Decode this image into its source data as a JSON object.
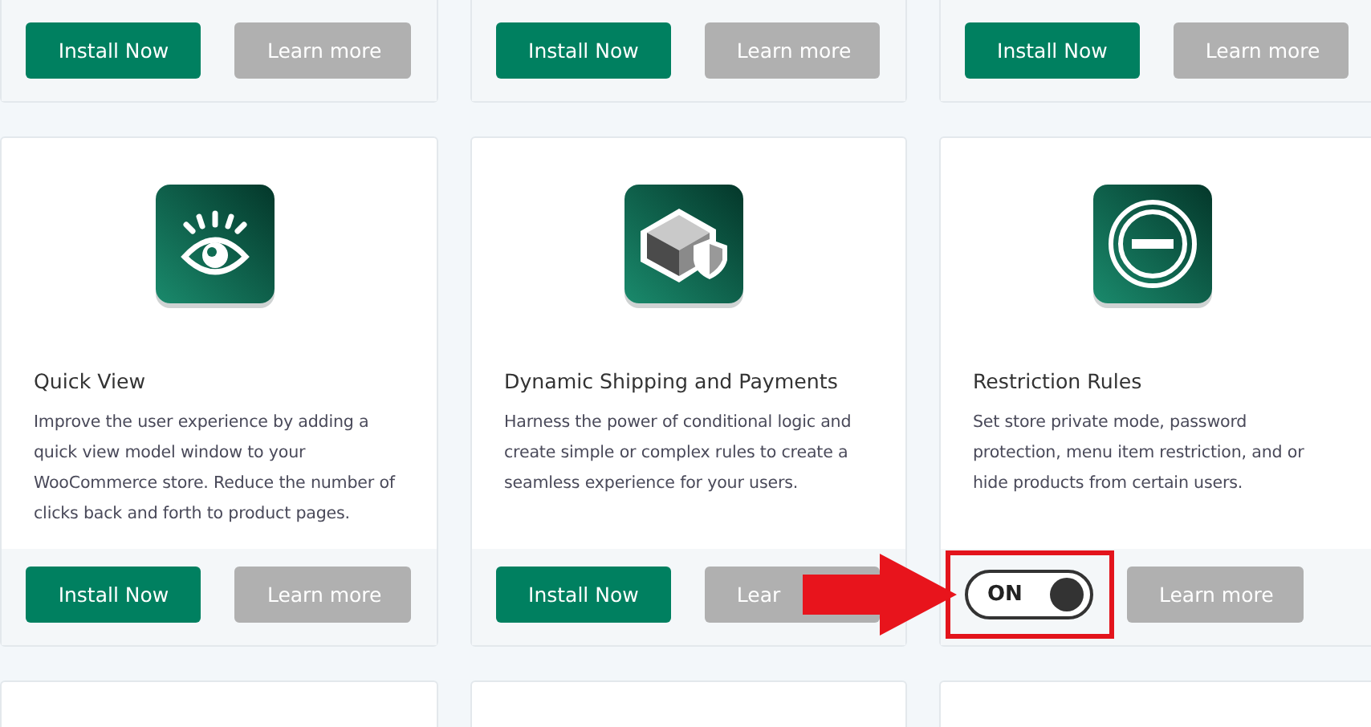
{
  "top_row": [
    {
      "actions": [
        {
          "kind": "install",
          "label": "Install Now"
        },
        {
          "kind": "learn",
          "label": "Learn more"
        }
      ]
    },
    {
      "actions": [
        {
          "kind": "install",
          "label": "Install Now"
        },
        {
          "kind": "learn",
          "label": "Learn more"
        }
      ]
    },
    {
      "actions": [
        {
          "kind": "install",
          "label": "Install Now"
        },
        {
          "kind": "learn",
          "label": "Learn more"
        }
      ]
    }
  ],
  "cards": [
    {
      "title": "Quick View",
      "description": "Improve the user experience by adding a quick view model window to your WooCommerce store. Reduce the number of clicks back and forth to product pages.",
      "actions": [
        {
          "kind": "install",
          "label": "Install Now"
        },
        {
          "kind": "learn",
          "label": "Learn more"
        }
      ]
    },
    {
      "title": "Dynamic Shipping and Payments",
      "description": "Harness the power of conditional logic and create simple or complex rules to create a seamless experience for your users.",
      "actions": [
        {
          "kind": "install",
          "label": "Install Now"
        },
        {
          "kind": "learn",
          "label": "Lear"
        }
      ]
    },
    {
      "title": "Restriction Rules",
      "description": "Set store private mode, password protection, menu item restriction, and or hide products from certain users.",
      "actions": [
        {
          "kind": "toggle",
          "label": "ON",
          "on": true,
          "highlighted": true
        },
        {
          "kind": "learn",
          "label": "Learn more"
        }
      ]
    }
  ]
}
